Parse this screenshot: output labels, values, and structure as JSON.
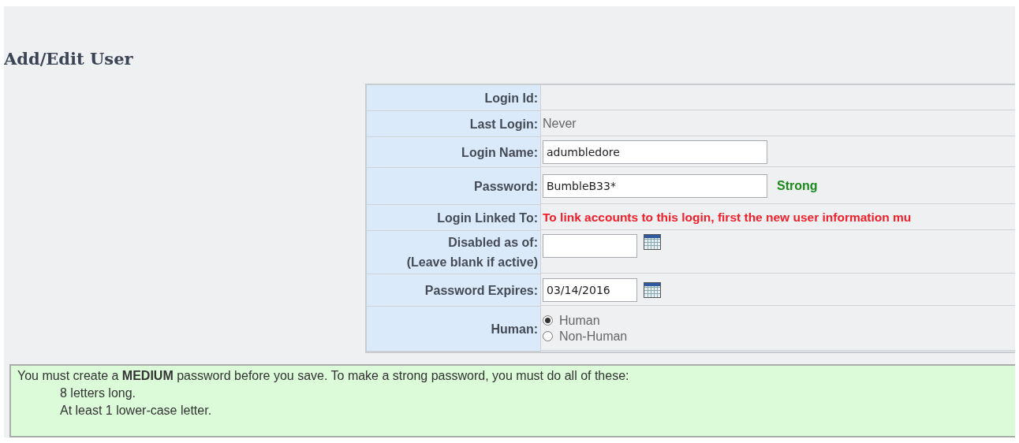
{
  "title": "Add/Edit User",
  "form": {
    "rows": [
      {
        "kind": "text",
        "label": "Login Id:",
        "value": ""
      },
      {
        "kind": "text",
        "label": "Last Login:",
        "value": "Never"
      },
      {
        "kind": "input",
        "label": "Login Name:",
        "value": "adumbledore"
      },
      {
        "kind": "password",
        "label": "Password:",
        "value": "BumbleB33*",
        "strength": "Strong"
      },
      {
        "kind": "warning",
        "label": "Login Linked To:",
        "value": "To link accounts to this login, first the new user information mu"
      },
      {
        "kind": "date",
        "label": "Disabled as of:",
        "note": "(Leave blank if active)",
        "value": ""
      },
      {
        "kind": "date",
        "label": "Password Expires:",
        "value": "03/14/2016"
      },
      {
        "kind": "radio",
        "label": "Human:",
        "options": [
          {
            "label": "Human",
            "selected": true
          },
          {
            "label": "Non-Human",
            "selected": false
          }
        ]
      }
    ]
  },
  "notice": {
    "text": "You must create a **MEDIUM** password before you save. To make a strong password, you must do all of these:",
    "requirements": [
      "8 letters long.",
      "At least 1 lower-case letter."
    ]
  }
}
